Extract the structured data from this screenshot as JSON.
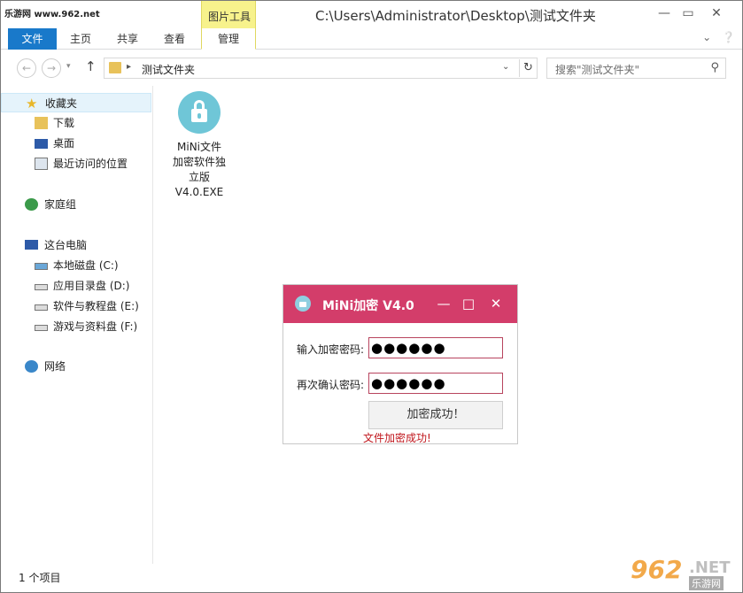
{
  "watermark_top": "乐游网 www.962.net",
  "titlebar": {
    "context_tab": "图片工具",
    "title": "C:\\Users\\Administrator\\Desktop\\测试文件夹"
  },
  "ribbon": {
    "tabs": [
      "文件",
      "主页",
      "共享",
      "查看",
      "管理"
    ]
  },
  "address": {
    "path": "测试文件夹",
    "search_placeholder": "搜索\"测试文件夹\""
  },
  "sidebar": {
    "items": [
      {
        "label": "收藏夹",
        "icon": "star-icon"
      },
      {
        "label": "下载",
        "icon": "download-folder-icon"
      },
      {
        "label": "桌面",
        "icon": "desktop-icon"
      },
      {
        "label": "最近访问的位置",
        "icon": "recent-places-icon"
      },
      {
        "label": "家庭组",
        "icon": "homegroup-icon"
      },
      {
        "label": "这台电脑",
        "icon": "computer-icon"
      },
      {
        "label": "本地磁盘 (C:)",
        "icon": "system-drive-icon"
      },
      {
        "label": "应用目录盘 (D:)",
        "icon": "drive-icon"
      },
      {
        "label": "软件与教程盘 (E:)",
        "icon": "drive-icon"
      },
      {
        "label": "游戏与资料盘 (F:)",
        "icon": "drive-icon"
      },
      {
        "label": "网络",
        "icon": "network-icon"
      }
    ]
  },
  "content": {
    "file": {
      "name": "MiNi文件\n加密软件独\n立版\nV4.0.EXE",
      "icon": "lock-icon"
    }
  },
  "statusbar": {
    "item_count": "1 个项目"
  },
  "watermark_bottom": {
    "number": "962",
    "net": ".NET",
    "site": "乐游网"
  },
  "dialog": {
    "title": "MiNi加密 V4.0",
    "password_label": "输入加密密码:",
    "password_value": "●●●●●●",
    "confirm_label": "再次确认密码:",
    "confirm_value": "●●●●●●",
    "submit_label": "加密成功！",
    "status": "文件加密成功!",
    "accent_color": "#d33d6a"
  }
}
